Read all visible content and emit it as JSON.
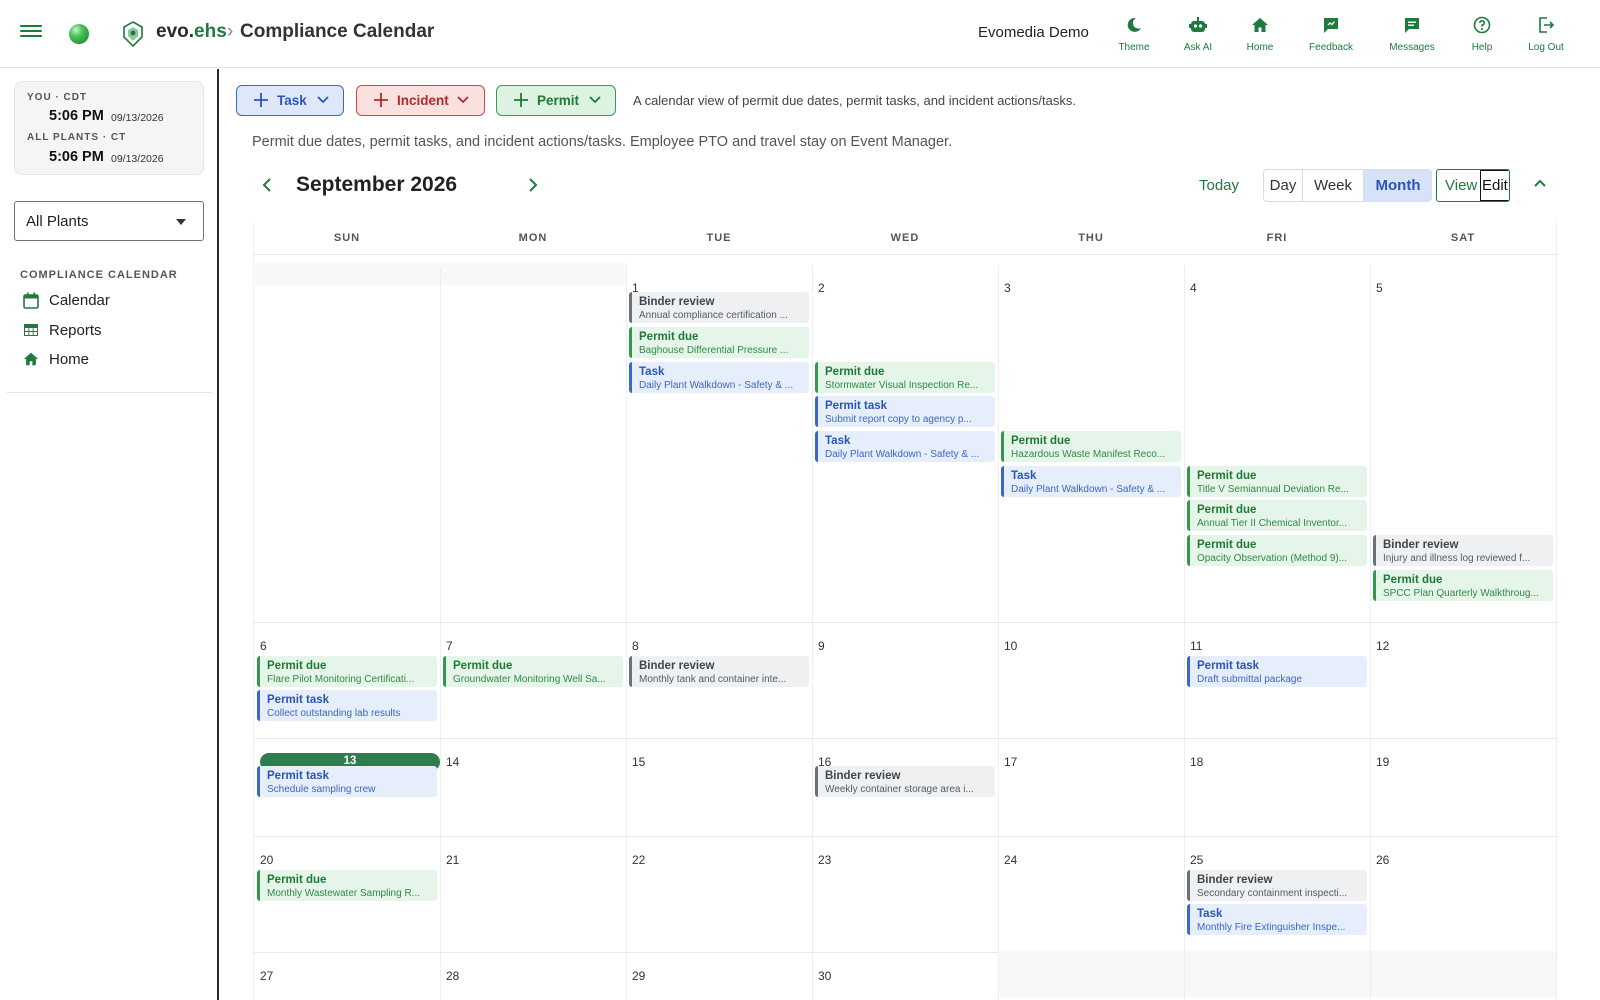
{
  "header": {
    "brand_prefix": "evo.",
    "brand_suffix": "ehs",
    "separator": "›",
    "page_title": "Compliance Calendar",
    "user": "Evomedia Demo",
    "actions": [
      {
        "label": "Theme",
        "icon": "moon-icon"
      },
      {
        "label": "Ask AI",
        "icon": "robot-icon"
      },
      {
        "label": "Home",
        "icon": "home-icon"
      },
      {
        "label": "Feedback",
        "icon": "feedback-icon"
      },
      {
        "label": "Messages",
        "icon": "messages-icon"
      },
      {
        "label": "Help",
        "icon": "help-icon"
      },
      {
        "label": "Log Out",
        "icon": "logout-icon"
      }
    ]
  },
  "sidebar": {
    "clock": {
      "you_label": "YOU · CDT",
      "you_time": "5:06 PM",
      "you_date": "09/13/2026",
      "plants_label": "ALL PLANTS · CT",
      "plants_time": "5:06 PM",
      "plants_date": "09/13/2026"
    },
    "plant_select": "All Plants",
    "section_title": "COMPLIANCE CALENDAR",
    "items": [
      {
        "label": "Calendar",
        "icon": "calendar-icon"
      },
      {
        "label": "Reports",
        "icon": "table-icon"
      },
      {
        "label": "Home",
        "icon": "home-icon"
      }
    ]
  },
  "toolbar": {
    "task_label": "Task",
    "incident_label": "Incident",
    "permit_label": "Permit",
    "info_short": "A calendar view of permit due dates, permit tasks, and incident actions/tasks.",
    "info_long": "Permit due dates, permit tasks, and incident actions/tasks. Employee PTO and travel stay on Event Manager."
  },
  "calendar": {
    "month_title": "September 2026",
    "today_label": "Today",
    "views": [
      "Day",
      "Week",
      "Month"
    ],
    "active_view": "Month",
    "view_label": "View",
    "edit_label": "Edit",
    "weekdays": [
      "SUN",
      "MON",
      "TUE",
      "WED",
      "THU",
      "FRI",
      "SAT"
    ],
    "today_date": "13",
    "weeks": [
      {
        "days": [
          {
            "num": "",
            "events": []
          },
          {
            "num": "",
            "events": []
          },
          {
            "num": "1",
            "events": [
              {
                "kind": "binder",
                "title": "Binder review",
                "sub": "Annual compliance certification ..."
              },
              {
                "kind": "pdue",
                "title": "Permit due",
                "sub": "Baghouse Differential Pressure ..."
              },
              {
                "kind": "task",
                "title": "Task",
                "sub": "Daily Plant Walkdown - Safety & ..."
              }
            ]
          },
          {
            "num": "2",
            "events": [
              {
                "kind": "pdue",
                "title": "Permit due",
                "sub": "Stormwater Visual Inspection Re..."
              },
              {
                "kind": "ptask",
                "title": "Permit task",
                "sub": "Submit report copy to agency p..."
              },
              {
                "kind": "task",
                "title": "Task",
                "sub": "Daily Plant Walkdown - Safety & ..."
              }
            ]
          },
          {
            "num": "3",
            "events": [
              {
                "kind": "pdue",
                "title": "Permit due",
                "sub": "Hazardous Waste Manifest Reco..."
              },
              {
                "kind": "task",
                "title": "Task",
                "sub": "Daily Plant Walkdown - Safety & ..."
              }
            ]
          },
          {
            "num": "4",
            "events": [
              {
                "kind": "pdue",
                "title": "Permit due",
                "sub": "Title V Semiannual Deviation Re..."
              },
              {
                "kind": "pdue",
                "title": "Permit due",
                "sub": "Annual Tier II Chemical Inventor..."
              },
              {
                "kind": "pdue",
                "title": "Permit due",
                "sub": "Opacity Observation (Method 9)..."
              }
            ]
          },
          {
            "num": "5",
            "events": [
              {
                "kind": "binder",
                "title": "Binder review",
                "sub": "Injury and illness log reviewed f..."
              },
              {
                "kind": "pdue",
                "title": "Permit due",
                "sub": "SPCC Plan Quarterly Walkthroug..."
              }
            ]
          }
        ]
      },
      {
        "days": [
          {
            "num": "6",
            "events": [
              {
                "kind": "pdue",
                "title": "Permit due",
                "sub": "Flare Pilot Monitoring Certificati..."
              },
              {
                "kind": "ptask",
                "title": "Permit task",
                "sub": "Collect outstanding lab results"
              }
            ]
          },
          {
            "num": "7",
            "events": [
              {
                "kind": "pdue",
                "title": "Permit due",
                "sub": "Groundwater Monitoring Well Sa..."
              }
            ]
          },
          {
            "num": "8",
            "events": [
              {
                "kind": "binder",
                "title": "Binder review",
                "sub": "Monthly tank and container inte..."
              }
            ]
          },
          {
            "num": "9",
            "events": []
          },
          {
            "num": "10",
            "events": []
          },
          {
            "num": "11",
            "events": [
              {
                "kind": "ptask",
                "title": "Permit task",
                "sub": "Draft submittal package"
              }
            ]
          },
          {
            "num": "12",
            "events": []
          }
        ]
      },
      {
        "days": [
          {
            "num": "13",
            "events": [
              {
                "kind": "ptask",
                "title": "Permit task",
                "sub": "Schedule sampling crew"
              }
            ]
          },
          {
            "num": "14",
            "events": []
          },
          {
            "num": "15",
            "events": []
          },
          {
            "num": "16",
            "events": [
              {
                "kind": "binder",
                "title": "Binder review",
                "sub": "Weekly container storage area i..."
              }
            ]
          },
          {
            "num": "17",
            "events": []
          },
          {
            "num": "18",
            "events": []
          },
          {
            "num": "19",
            "events": []
          }
        ]
      },
      {
        "days": [
          {
            "num": "20",
            "events": [
              {
                "kind": "pdue",
                "title": "Permit due",
                "sub": "Monthly Wastewater Sampling R..."
              }
            ]
          },
          {
            "num": "21",
            "events": []
          },
          {
            "num": "22",
            "events": []
          },
          {
            "num": "23",
            "events": []
          },
          {
            "num": "24",
            "events": []
          },
          {
            "num": "25",
            "events": [
              {
                "kind": "binder",
                "title": "Binder review",
                "sub": "Secondary containment inspecti..."
              },
              {
                "kind": "task",
                "title": "Task",
                "sub": "Monthly Fire Extinguisher Inspe..."
              }
            ]
          },
          {
            "num": "26",
            "events": []
          }
        ]
      },
      {
        "days": [
          {
            "num": "27",
            "events": []
          },
          {
            "num": "28",
            "events": []
          },
          {
            "num": "29",
            "events": []
          },
          {
            "num": "30",
            "events": []
          },
          {
            "num": "",
            "events": []
          },
          {
            "num": "",
            "events": []
          },
          {
            "num": "",
            "events": []
          }
        ]
      }
    ]
  },
  "colors": {
    "brand_green": "#1f7a3f",
    "task_blue": "#3b67c9",
    "incident_red": "#c94a4a",
    "permit_green": "#2e9a4a",
    "binder_gray": "#6b7178",
    "today_pill": "#2f7d4e"
  }
}
